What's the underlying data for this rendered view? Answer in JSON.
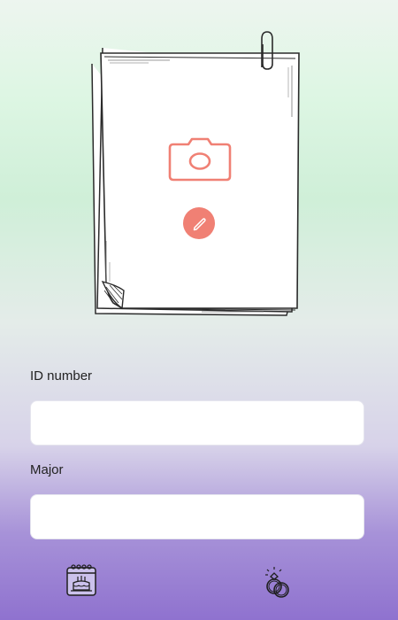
{
  "photo": {
    "camera_icon": "camera-icon",
    "edit_icon": "pencil-icon",
    "accent_color": "#f08074"
  },
  "form": {
    "id_label": "ID number",
    "id_value": "",
    "major_label": "Major",
    "major_value": ""
  },
  "bottom_bar": {
    "left_icon": "birthday-calendar-icon",
    "right_icon": "wedding-rings-icon"
  }
}
